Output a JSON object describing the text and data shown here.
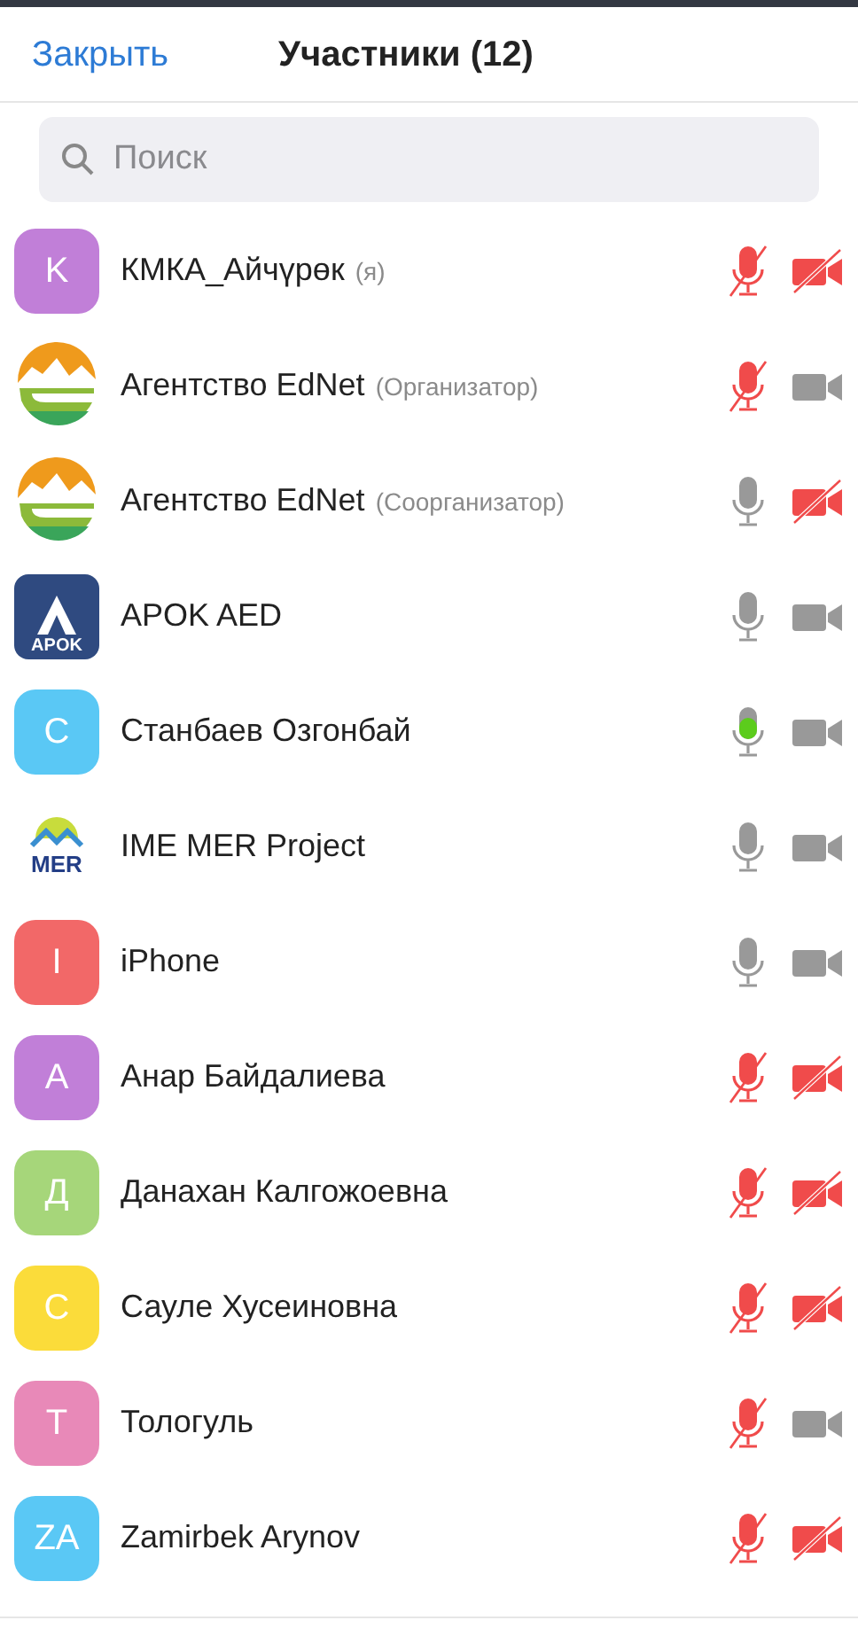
{
  "header": {
    "close": "Закрыть",
    "title": "Участники (12)"
  },
  "search": {
    "placeholder": "Поиск"
  },
  "participants": [
    {
      "avatar": {
        "kind": "letter",
        "letter": "K",
        "color": "#c17fd8"
      },
      "name": "КМКА_Айчүрөк",
      "role": "(я)",
      "mic_muted": true,
      "speaking": false,
      "video_off": true
    },
    {
      "avatar": {
        "kind": "ednet"
      },
      "name": "Агентство EdNet",
      "role": "(Организатор)",
      "mic_muted": true,
      "speaking": false,
      "video_off": false
    },
    {
      "avatar": {
        "kind": "ednet"
      },
      "name": "Агентство EdNet",
      "role": "(Соорганизатор)",
      "mic_muted": false,
      "speaking": false,
      "video_off": true
    },
    {
      "avatar": {
        "kind": "apok",
        "text": "APOK"
      },
      "name": "APOK AED",
      "mic_muted": false,
      "speaking": false,
      "video_off": false
    },
    {
      "avatar": {
        "kind": "letter",
        "letter": "C",
        "color": "#5ac8f5"
      },
      "name": "Станбаев Озгонбай",
      "mic_muted": false,
      "speaking": true,
      "video_off": false
    },
    {
      "avatar": {
        "kind": "mer",
        "text": "MER"
      },
      "name": "IME MER Project",
      "mic_muted": false,
      "speaking": false,
      "video_off": false
    },
    {
      "avatar": {
        "kind": "letter",
        "letter": "I",
        "color": "#f26868"
      },
      "name": "iPhone",
      "mic_muted": false,
      "speaking": false,
      "video_off": false
    },
    {
      "avatar": {
        "kind": "letter",
        "letter": "A",
        "color": "#c17fd8"
      },
      "name": "Анар Байдалиева",
      "mic_muted": true,
      "speaking": false,
      "video_off": true
    },
    {
      "avatar": {
        "kind": "letter",
        "letter": "Д",
        "color": "#a6d67a"
      },
      "name": "Данахан Калгожоевна",
      "mic_muted": true,
      "speaking": false,
      "video_off": true
    },
    {
      "avatar": {
        "kind": "letter",
        "letter": "C",
        "color": "#fbdc3a"
      },
      "name": "Сауле Хусеиновна",
      "mic_muted": true,
      "speaking": false,
      "video_off": true
    },
    {
      "avatar": {
        "kind": "letter",
        "letter": "T",
        "color": "#e889b8"
      },
      "name": "Тологуль",
      "mic_muted": true,
      "speaking": false,
      "video_off": false
    },
    {
      "avatar": {
        "kind": "letter",
        "letter": "ZA",
        "color": "#5ac8f5"
      },
      "name": "Zamirbek Arynov",
      "mic_muted": true,
      "speaking": false,
      "video_off": true
    }
  ]
}
